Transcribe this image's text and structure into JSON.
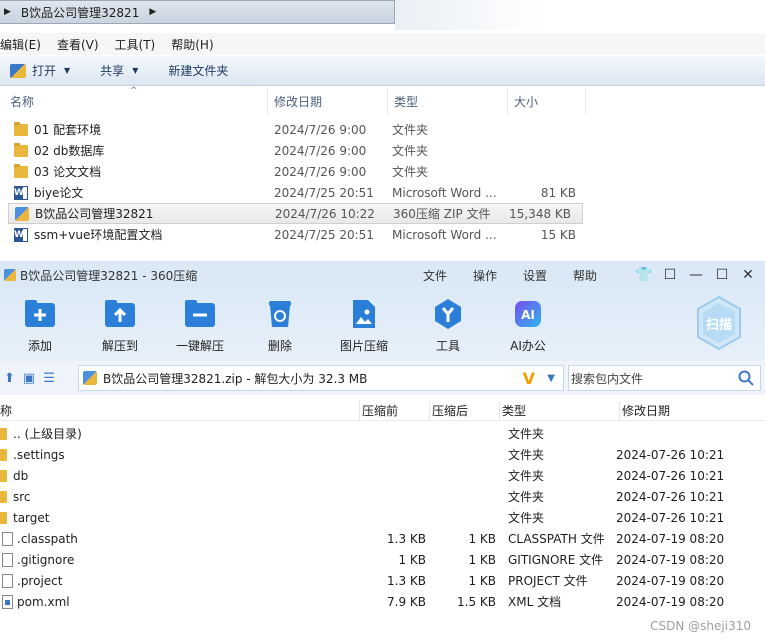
{
  "explorer": {
    "breadcrumb": "B饮品公司管理32821",
    "menu": [
      "编辑(E)",
      "查看(V)",
      "工具(T)",
      "帮助(H)"
    ],
    "toolbar": {
      "open": "打开",
      "share": "共享",
      "new_folder": "新建文件夹"
    },
    "columns": {
      "name": "名称",
      "date": "修改日期",
      "type": "类型",
      "size": "大小"
    },
    "rows": [
      {
        "icon": "folder-icon",
        "name": "01 配套环境",
        "date": "2024/7/26 9:00",
        "type": "文件夹",
        "size": ""
      },
      {
        "icon": "folder-icon",
        "name": "02 db数据库",
        "date": "2024/7/26 9:00",
        "type": "文件夹",
        "size": ""
      },
      {
        "icon": "folder-icon",
        "name": "03 论文文档",
        "date": "2024/7/26 9:00",
        "type": "文件夹",
        "size": ""
      },
      {
        "icon": "word-icon",
        "name": "biye论文",
        "date": "2024/7/25 20:51",
        "type": "Microsoft Word ...",
        "size": "81 KB"
      },
      {
        "icon": "zip-icon",
        "name": "B饮品公司管理32821",
        "date": "2024/7/26 10:22",
        "type": "360压缩 ZIP 文件",
        "size": "15,348 KB",
        "selected": true
      },
      {
        "icon": "word-icon",
        "name": "ssm+vue环境配置文档",
        "date": "2024/7/25 20:51",
        "type": "Microsoft Word ...",
        "size": "15 KB"
      }
    ]
  },
  "zip": {
    "title": "B饮品公司管理32821 - 360压缩",
    "menu": [
      "文件",
      "操作",
      "设置",
      "帮助"
    ],
    "tools": [
      "添加",
      "解压到",
      "一键解压",
      "删除",
      "图片压缩",
      "工具",
      "AI办公"
    ],
    "scan_label": "扫描",
    "path": "B饮品公司管理32821.zip - 解包大小为 32.3 MB",
    "search_placeholder": "搜索包内文件",
    "columns": {
      "name": "名称",
      "csize": "压缩前",
      "usize": "压缩后",
      "type": "类型",
      "date": "修改日期"
    },
    "rows": [
      {
        "icon": "folder-icon",
        "name": ".. (上级目录)",
        "csize": "",
        "usize": "",
        "type": "文件夹",
        "date": ""
      },
      {
        "icon": "folder-icon",
        "name": ".settings",
        "csize": "",
        "usize": "",
        "type": "文件夹",
        "date": "2024-07-26 10:21"
      },
      {
        "icon": "folder-icon",
        "name": "db",
        "csize": "",
        "usize": "",
        "type": "文件夹",
        "date": "2024-07-26 10:21"
      },
      {
        "icon": "folder-icon",
        "name": "src",
        "csize": "",
        "usize": "",
        "type": "文件夹",
        "date": "2024-07-26 10:21"
      },
      {
        "icon": "folder-icon",
        "name": "target",
        "csize": "",
        "usize": "",
        "type": "文件夹",
        "date": "2024-07-26 10:21"
      },
      {
        "icon": "file-icon",
        "name": ".classpath",
        "csize": "1.3 KB",
        "usize": "1 KB",
        "type": "CLASSPATH 文件",
        "date": "2024-07-19 08:20"
      },
      {
        "icon": "file-icon",
        "name": ".gitignore",
        "csize": "1 KB",
        "usize": "1 KB",
        "type": "GITIGNORE 文件",
        "date": "2024-07-19 08:20"
      },
      {
        "icon": "file-icon",
        "name": ".project",
        "csize": "1.3 KB",
        "usize": "1 KB",
        "type": "PROJECT 文件",
        "date": "2024-07-19 08:20"
      },
      {
        "icon": "xml-file-icon",
        "name": "pom.xml",
        "csize": "7.9 KB",
        "usize": "1.5 KB",
        "type": "XML 文档",
        "date": "2024-07-19 08:20"
      }
    ]
  },
  "watermark": "CSDN @sheji310"
}
